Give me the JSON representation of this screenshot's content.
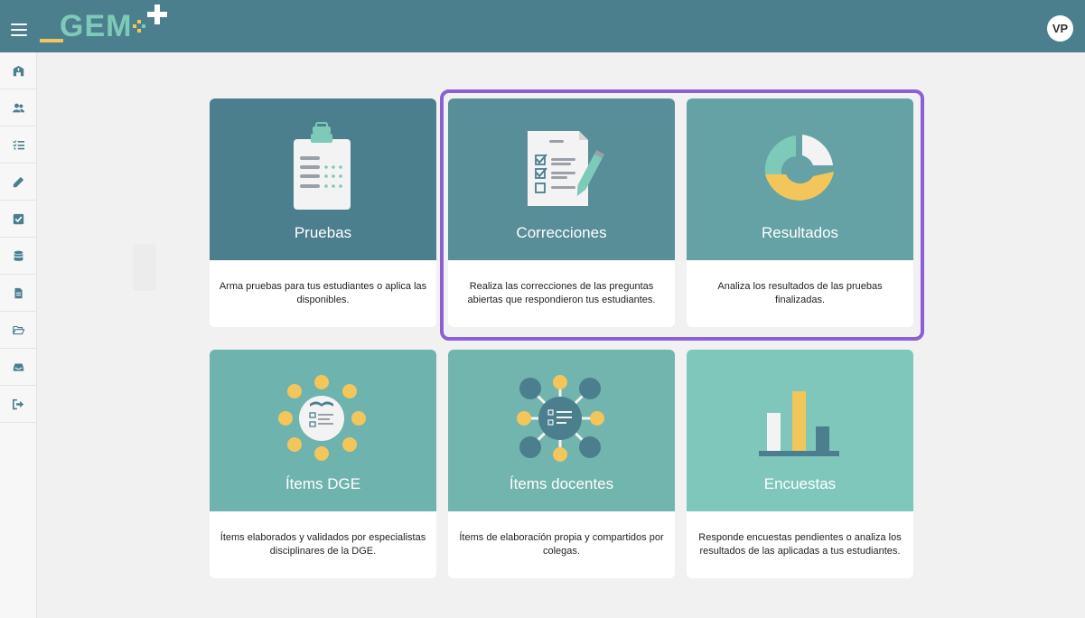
{
  "header": {
    "logo_text": "GEM+",
    "user_initials": "VP"
  },
  "sidebar": {
    "items": [
      {
        "icon": "school-icon"
      },
      {
        "icon": "users-icon"
      },
      {
        "icon": "checklist-icon"
      },
      {
        "icon": "pencil-icon"
      },
      {
        "icon": "checkbox-icon"
      },
      {
        "icon": "database-icon"
      },
      {
        "icon": "document-icon"
      },
      {
        "icon": "folder-open-icon"
      },
      {
        "icon": "inbox-icon"
      },
      {
        "icon": "logout-icon"
      }
    ]
  },
  "cards": [
    {
      "title": "Pruebas",
      "description": "Arma pruebas para tus estudiantes o aplica las disponibles.",
      "color": "#4b7f8d"
    },
    {
      "title": "Correcciones",
      "description": "Realiza las correcciones de las preguntas abiertas que respondieron tus estudiantes.",
      "color": "#578e98"
    },
    {
      "title": "Resultados",
      "description": "Analiza los resultados de las pruebas finalizadas.",
      "color": "#64a2a5"
    },
    {
      "title": "Ítems DGE",
      "description": "Ítems elaborados y validados por especialistas disciplinares de la DGE.",
      "color": "#6fb3ae"
    },
    {
      "title": "Ítems docentes",
      "description": "Ítems de elaboración propia y compartidos por colegas.",
      "color": "#72b4ae"
    },
    {
      "title": "Encuestas",
      "description": "Responde encuestas pendientes o analiza los resultados de las aplicadas a tus estudiantes.",
      "color": "#80c7bb"
    }
  ],
  "colors": {
    "header": "#4b7f8d",
    "accent_yellow": "#f2c65a",
    "teal_light": "#7ecab9",
    "highlight_border": "#8c5fd6"
  }
}
